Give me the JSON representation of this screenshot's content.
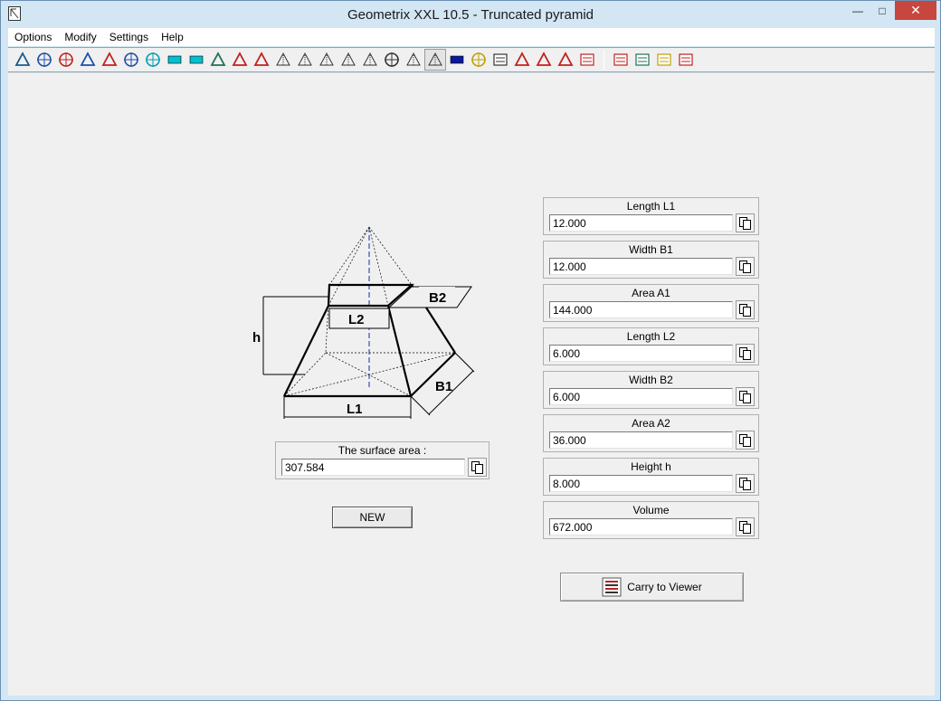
{
  "window": {
    "title": "Geometrix XXL 10.5 - Truncated pyramid",
    "minimize": "—",
    "maximize": "□",
    "close": "✕"
  },
  "menu": [
    "Options",
    "Modify",
    "Settings",
    "Help"
  ],
  "toolbar": {
    "tools": [
      {
        "icon": "angle-tool-icon",
        "color": "#1a5a8a"
      },
      {
        "icon": "circle-crosshair-icon",
        "color": "#1e4ea8"
      },
      {
        "icon": "circle-crosshair-red-icon",
        "color": "#c02020"
      },
      {
        "icon": "notch-profile-icon",
        "color": "#1e4ea8"
      },
      {
        "icon": "i-beam-icon",
        "color": "#c02020"
      },
      {
        "icon": "ring-icon",
        "color": "#1e4ea8"
      },
      {
        "icon": "ring-cyan-icon",
        "color": "#00a0b0"
      },
      {
        "icon": "rectangle-icon",
        "color": "#00c0d0"
      },
      {
        "icon": "parallelogram-icon",
        "color": "#00c0d0"
      },
      {
        "icon": "right-triangle-icon",
        "color": "#207050"
      },
      {
        "icon": "triangle-icon",
        "color": "#c02020"
      },
      {
        "icon": "circle-triangle-icon",
        "color": "#c02020"
      },
      {
        "icon": "cube-icon",
        "color": "#333333"
      },
      {
        "icon": "cylinder-icon",
        "color": "#333333"
      },
      {
        "icon": "barrel-icon",
        "color": "#333333"
      },
      {
        "icon": "pyramid-icon",
        "color": "#333333"
      },
      {
        "icon": "pyramid-dotted-icon",
        "color": "#333333"
      },
      {
        "icon": "sphere-icon",
        "color": "#333333"
      },
      {
        "icon": "cone-icon",
        "color": "#333333"
      },
      {
        "icon": "truncated-pyramid-icon",
        "color": "#333333",
        "active": true
      },
      {
        "icon": "frustum-filled-icon",
        "color": "#0a1a9a"
      },
      {
        "icon": "lens-icon",
        "color": "#c0a000"
      },
      {
        "icon": "padlock-box-icon",
        "color": "#333333"
      },
      {
        "icon": "unit-conversion-icon",
        "color": "#c02020"
      },
      {
        "icon": "scatter-points-icon",
        "color": "#c02020"
      },
      {
        "icon": "connect-points-icon",
        "color": "#c02020"
      },
      {
        "icon": "link-icon",
        "color": "#c02020"
      },
      {
        "icon": "viewer-icon",
        "color": "#c02020",
        "separator_before": true
      },
      {
        "icon": "calculator-icon",
        "color": "#207050"
      },
      {
        "icon": "printer-icon",
        "color": "#c0a000"
      },
      {
        "icon": "exit-icon",
        "color": "#c02020"
      }
    ]
  },
  "drawing": {
    "labels": {
      "b2": "B2",
      "l2": "L2",
      "h": "h",
      "b1": "B1",
      "l1": "L1"
    }
  },
  "surface": {
    "label": "The surface area :",
    "value": "307.584"
  },
  "new_button": "NEW",
  "fields": [
    {
      "label": "Length L1",
      "value": "12.000"
    },
    {
      "label": "Width B1",
      "value": "12.000"
    },
    {
      "label": "Area A1",
      "value": "144.000"
    },
    {
      "label": "Length L2",
      "value": "6.000"
    },
    {
      "label": "Width B2",
      "value": "6.000"
    },
    {
      "label": "Area A2",
      "value": "36.000"
    },
    {
      "label": "Height h",
      "value": "8.000"
    },
    {
      "label": "Volume",
      "value": "672.000"
    }
  ],
  "carry_button": "Carry to Viewer"
}
